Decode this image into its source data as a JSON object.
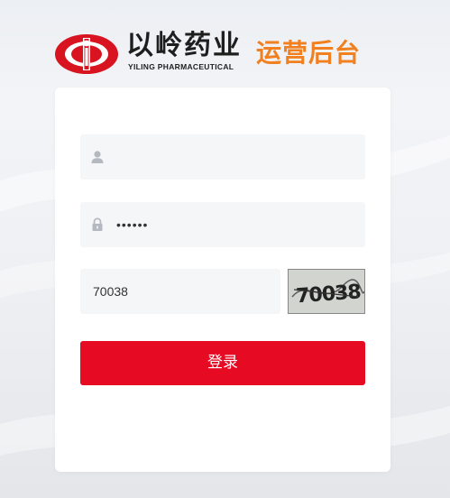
{
  "brand": {
    "logo_icon": "yiling-logo-icon",
    "name_zh": "以岭药业",
    "name_en": "YILING PHARMACEUTICAL",
    "subtitle": "运营后台",
    "colors": {
      "logo_red": "#d7141f",
      "subtitle_orange": "#f08020"
    }
  },
  "login_form": {
    "username": {
      "icon": "user-icon",
      "value": "",
      "placeholder": ""
    },
    "password": {
      "icon": "lock-icon",
      "value": "123456",
      "placeholder": ""
    },
    "captcha": {
      "value": "70038",
      "placeholder": "",
      "image_text": "70038"
    },
    "submit_label": "登录",
    "colors": {
      "button": "#e60a23",
      "field_bg": "#f5f6f8"
    }
  }
}
